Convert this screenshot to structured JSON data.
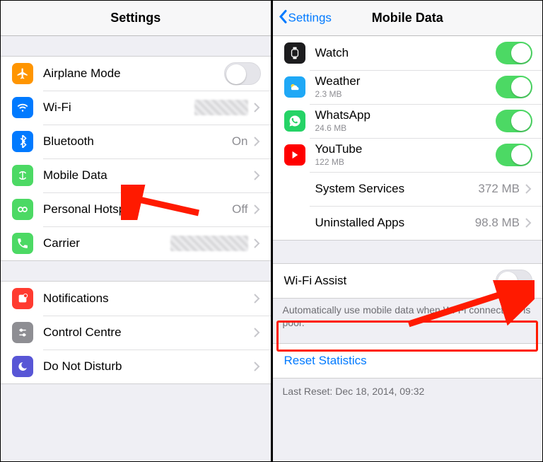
{
  "left": {
    "title": "Settings",
    "group1": [
      {
        "label": "Airplane Mode",
        "toggle": false
      },
      {
        "label": "Wi-Fi",
        "value_blurred": true
      },
      {
        "label": "Bluetooth",
        "value": "On"
      },
      {
        "label": "Mobile Data"
      },
      {
        "label": "Personal Hotspot",
        "value": "Off"
      },
      {
        "label": "Carrier",
        "value_blurred": true
      }
    ],
    "group2": [
      {
        "label": "Notifications"
      },
      {
        "label": "Control Centre"
      },
      {
        "label": "Do Not Disturb"
      }
    ]
  },
  "right": {
    "back": "Settings",
    "title": "Mobile Data",
    "apps": [
      {
        "label": "Watch",
        "sub": "",
        "toggle": true
      },
      {
        "label": "Weather",
        "sub": "2.3 MB",
        "toggle": true
      },
      {
        "label": "WhatsApp",
        "sub": "24.6 MB",
        "toggle": true
      },
      {
        "label": "YouTube",
        "sub": "122 MB",
        "toggle": true
      }
    ],
    "sysservices": {
      "label": "System Services",
      "value": "372 MB"
    },
    "uninstalled": {
      "label": "Uninstalled Apps",
      "value": "98.8 MB"
    },
    "wifi_assist": {
      "label": "Wi-Fi Assist",
      "toggle": false
    },
    "wifi_assist_desc": "Automatically use mobile data when Wi-Fi connectivity is poor.",
    "reset": "Reset Statistics",
    "last_reset": "Last Reset: Dec 18, 2014, 09:32"
  }
}
